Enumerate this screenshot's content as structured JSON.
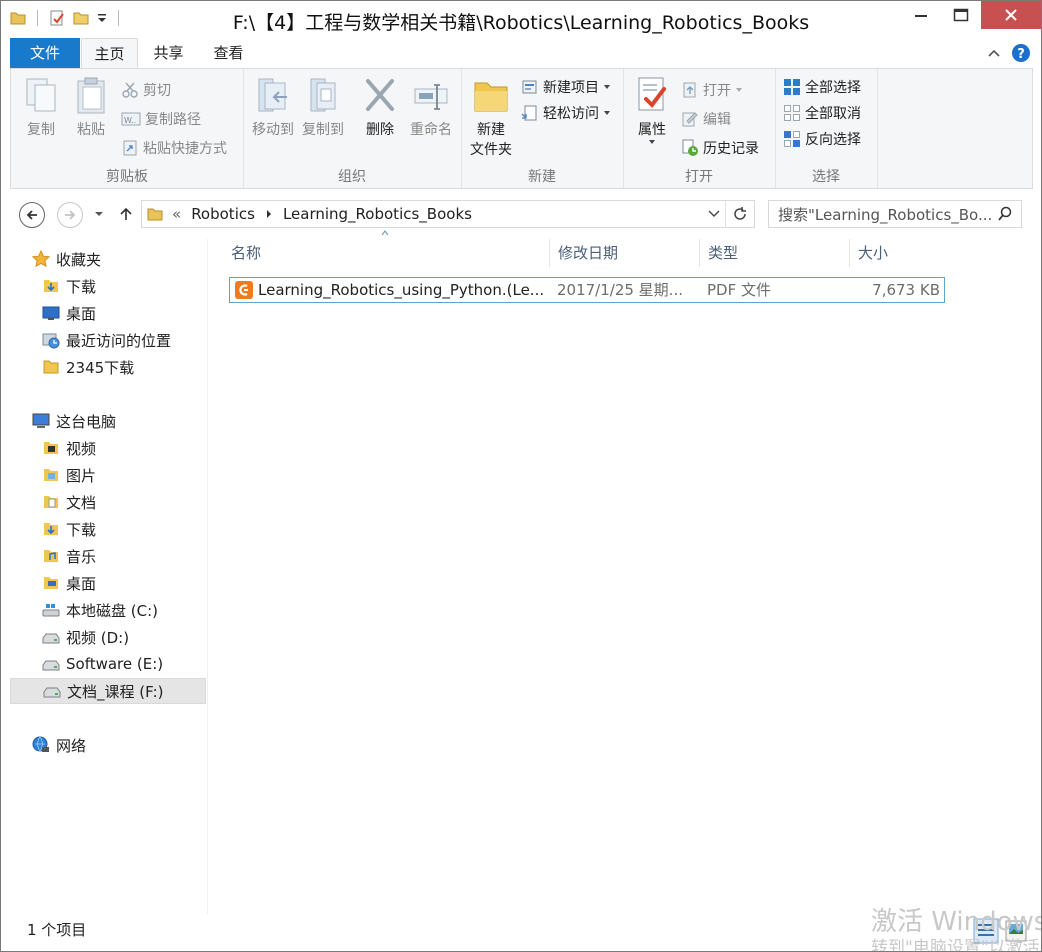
{
  "window": {
    "title": "F:\\【4】工程与数学相关书籍\\Robotics\\Learning_Robotics_Books"
  },
  "tabs": {
    "file": "文件",
    "home": "主页",
    "share": "共享",
    "view": "查看"
  },
  "ribbon": {
    "clipboard": {
      "label": "剪贴板",
      "copy": "复制",
      "paste": "粘贴",
      "cut": "剪切",
      "copy_path": "复制路径",
      "paste_shortcut": "粘贴快捷方式"
    },
    "organize": {
      "label": "组织",
      "move_to": "移动到",
      "copy_to": "复制到",
      "delete": "删除",
      "rename": "重命名"
    },
    "new": {
      "label": "新建",
      "new_folder_line1": "新建",
      "new_folder_line2": "文件夹",
      "new_item": "新建项目",
      "easy_access": "轻松访问"
    },
    "open": {
      "label": "打开",
      "properties": "属性",
      "open": "打开",
      "edit": "编辑",
      "history": "历史记录"
    },
    "select": {
      "label": "选择",
      "select_all": "全部选择",
      "select_none": "全部取消",
      "invert": "反向选择"
    }
  },
  "address": {
    "crumbs": [
      "Robotics",
      "Learning_Robotics_Books"
    ],
    "search_placeholder": "搜索\"Learning_Robotics_Bo..."
  },
  "nav": {
    "favorites": "收藏夹",
    "fav_items": [
      "下载",
      "桌面",
      "最近访问的位置",
      "2345下载"
    ],
    "this_pc": "这台电脑",
    "pc_items": [
      "视频",
      "图片",
      "文档",
      "下载",
      "音乐",
      "桌面",
      "本地磁盘 (C:)",
      "视频 (D:)",
      "Software (E:)",
      "文档_课程 (F:)"
    ],
    "network": "网络"
  },
  "columns": {
    "name": "名称",
    "date": "修改日期",
    "type": "类型",
    "size": "大小"
  },
  "files": [
    {
      "name": "Learning_Robotics_using_Python.(Le...",
      "date": "2017/1/25 星期...",
      "type": "PDF 文件",
      "size": "7,673 KB"
    }
  ],
  "status": {
    "count": "1 个项目"
  },
  "watermark": {
    "line1": "激活 Windows",
    "line2": "转到\"电脑设置\"以激活"
  },
  "colors": {
    "accent": "#1979ca",
    "close": "#c75050",
    "selection_border": "#5ba6cf"
  }
}
